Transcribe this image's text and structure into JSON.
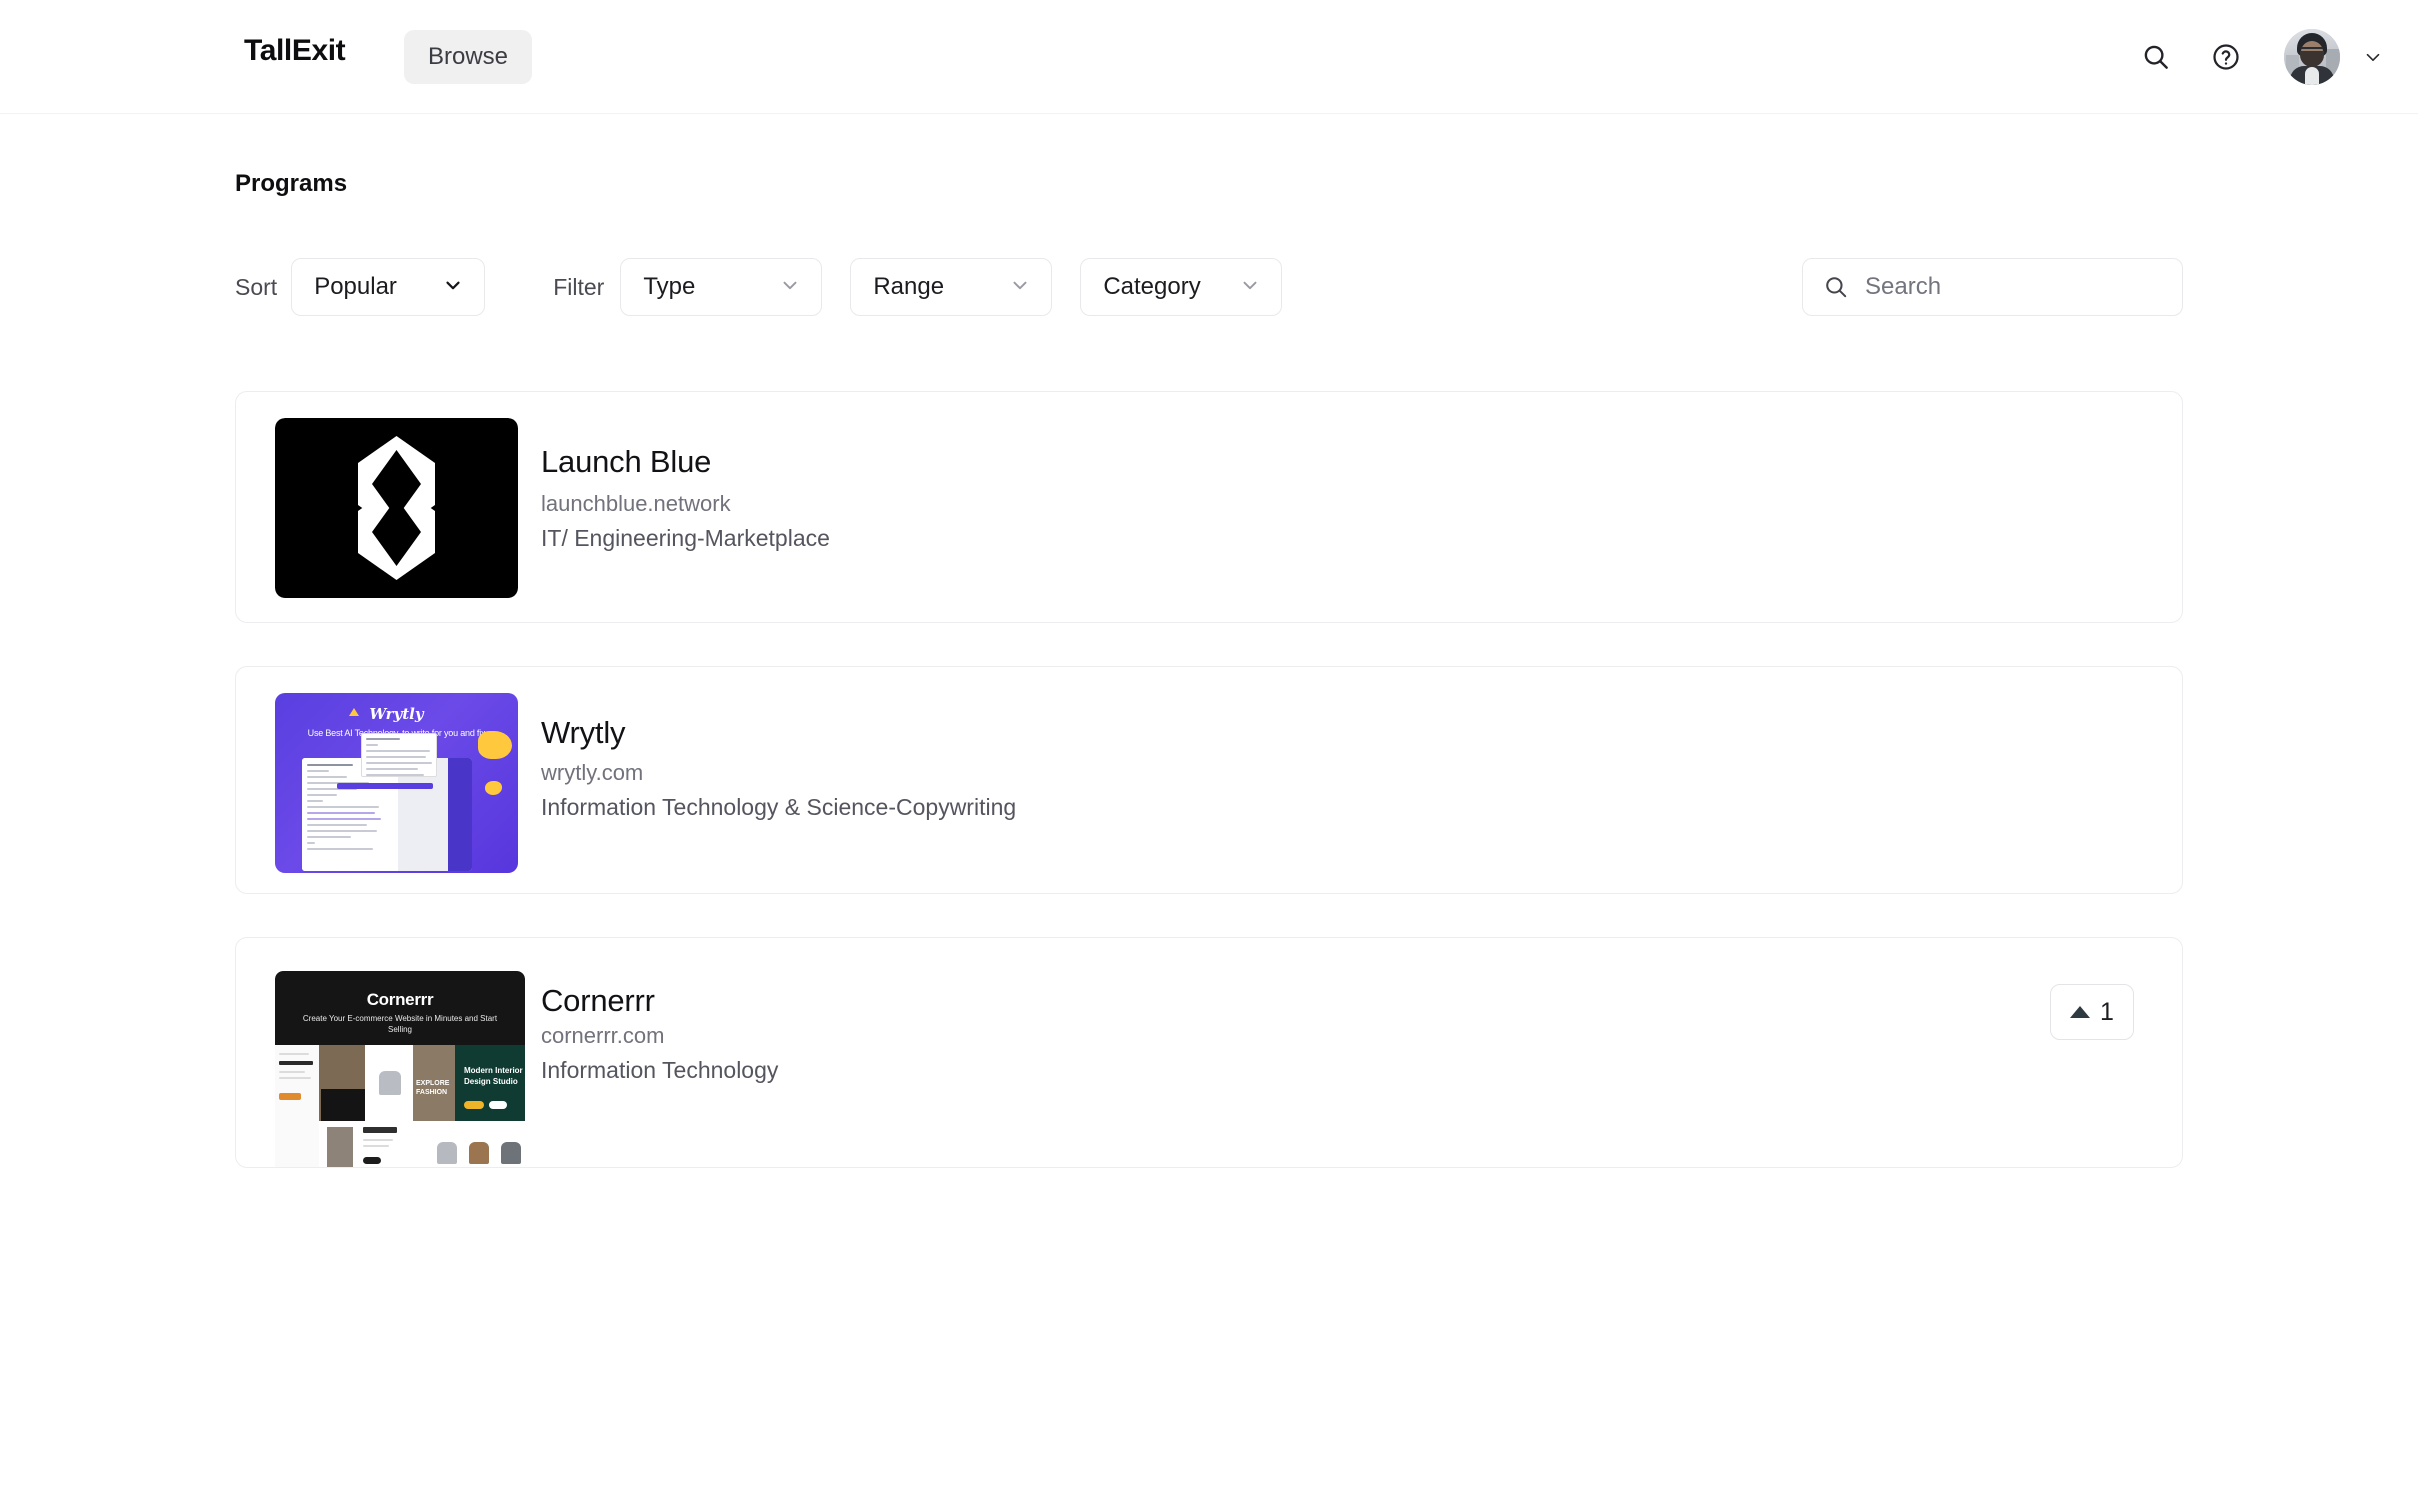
{
  "header": {
    "brand": "TallExit",
    "nav": {
      "browse": "Browse"
    },
    "icons": {
      "search": "search-icon",
      "help": "help-circle-icon",
      "avatar": "user-avatar",
      "chevron": "chevron-down-icon"
    }
  },
  "page": {
    "title": "Programs"
  },
  "controls": {
    "sort_label": "Sort",
    "sort_value": "Popular",
    "filter_label": "Filter",
    "type_value": "Type",
    "range_value": "Range",
    "category_value": "Category"
  },
  "search": {
    "placeholder": "Search",
    "value": ""
  },
  "cards": [
    {
      "name": "Launch Blue",
      "domain": "launchblue.network",
      "category": "IT/ Engineering-Marketplace",
      "thumb_type": "logo",
      "thumb_bg": "#000000",
      "has_upvote": false
    },
    {
      "name": "Wrytly",
      "domain": "wrytly.com",
      "category": "Information Technology & Science-Copywriting",
      "thumb_type": "screenshot",
      "thumb_bg": "#5a3fe0",
      "thumb_logo": "Wrytly",
      "thumb_tagline": "Use Best AI Technology, to write for you and fix mistakes",
      "has_upvote": false
    },
    {
      "name": "Cornerrr",
      "domain": "cornerrr.com",
      "category": "Information Technology",
      "thumb_type": "screenshot",
      "thumb_bg": "#151515",
      "thumb_logo": "Cornerrr",
      "thumb_tagline": "Create Your E-commerce Website in Minutes and Start Selling",
      "thumb_panel_text": "Modern Interior Design Studio",
      "has_upvote": true,
      "upvote_count": "1"
    }
  ],
  "colors": {
    "text_primary": "#121216",
    "text_muted": "#72727d",
    "border": "#ededf0",
    "nav_pill_bg": "#f0f0f1"
  }
}
